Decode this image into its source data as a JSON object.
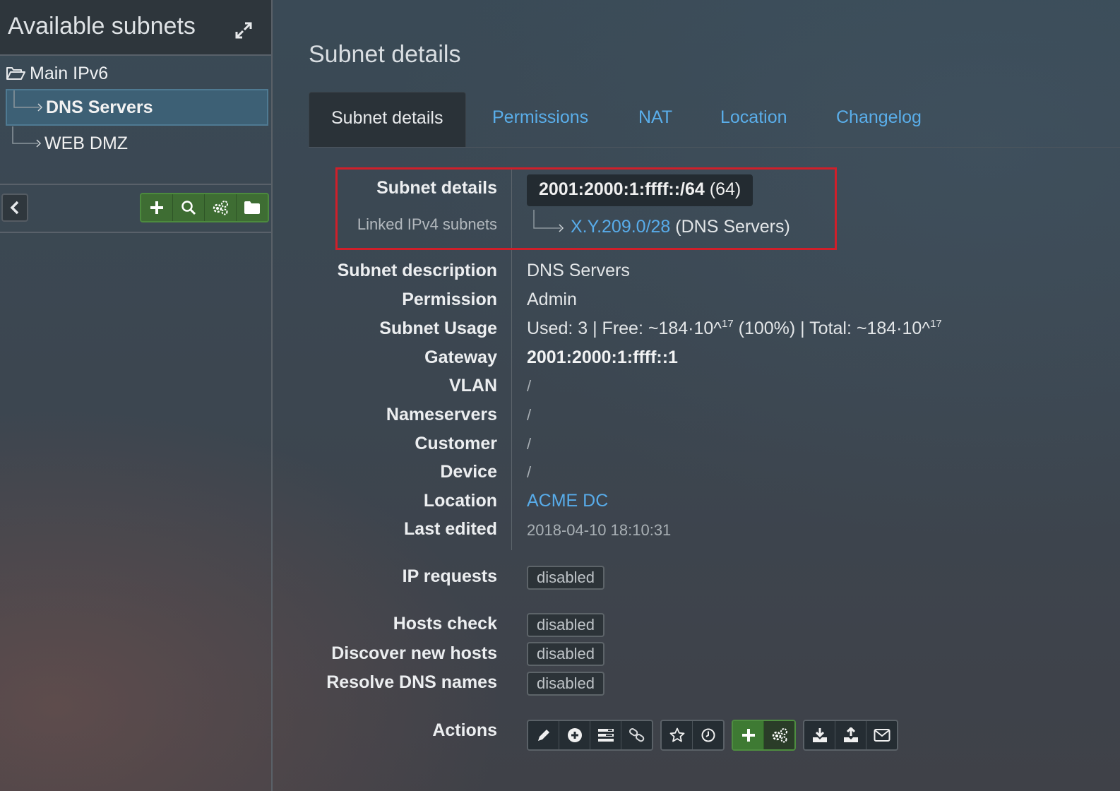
{
  "sidebar": {
    "title": "Available subnets",
    "section_folder": "Main IPv6",
    "items": [
      {
        "label": "DNS Servers",
        "active": true
      },
      {
        "label": "WEB DMZ",
        "active": false
      }
    ],
    "toolbar_icons": [
      "plus-icon",
      "search-icon",
      "gears-icon",
      "folder-icon"
    ]
  },
  "main": {
    "title": "Subnet details",
    "tabs": [
      "Subnet details",
      "Permissions",
      "NAT",
      "Location",
      "Changelog"
    ],
    "details": {
      "subnet_label": "Subnet details",
      "subnet_address": "2001:2000:1:ffff::/64",
      "subnet_mask": "(64)",
      "linked_label": "Linked IPv4 subnets",
      "linked_subnet": "X.Y.209.0/28",
      "linked_desc": "(DNS Servers)",
      "rows": [
        {
          "label": "Subnet description",
          "value": "DNS Servers"
        },
        {
          "label": "Permission",
          "value": "Admin"
        },
        {
          "label": "Subnet Usage",
          "value_parts": [
            "Used: 3 | Free: ~184·10^",
            "17",
            " (100%) | Total: ~184·10^",
            "17"
          ]
        },
        {
          "label": "Gateway",
          "value": "2001:2000:1:ffff::1"
        },
        {
          "label": "VLAN",
          "value": "/"
        },
        {
          "label": "Nameservers",
          "value": "/"
        },
        {
          "label": "Customer",
          "value": "/"
        },
        {
          "label": "Device",
          "value": "/"
        },
        {
          "label": "Location",
          "value": "ACME DC"
        },
        {
          "label": "Last edited",
          "value": "2018-04-10 18:10:31"
        }
      ],
      "ip_requests": {
        "label": "IP requests",
        "value": "disabled"
      },
      "hosts_check": {
        "label": "Hosts check",
        "value": "disabled"
      },
      "discover_hosts": {
        "label": "Discover new hosts",
        "value": "disabled"
      },
      "resolve_dns": {
        "label": "Resolve DNS names",
        "value": "disabled"
      },
      "actions_label": "Actions"
    }
  },
  "colors": {
    "link": "#58acea",
    "highlight": "#d01f2a",
    "success": "#3e7a33"
  }
}
